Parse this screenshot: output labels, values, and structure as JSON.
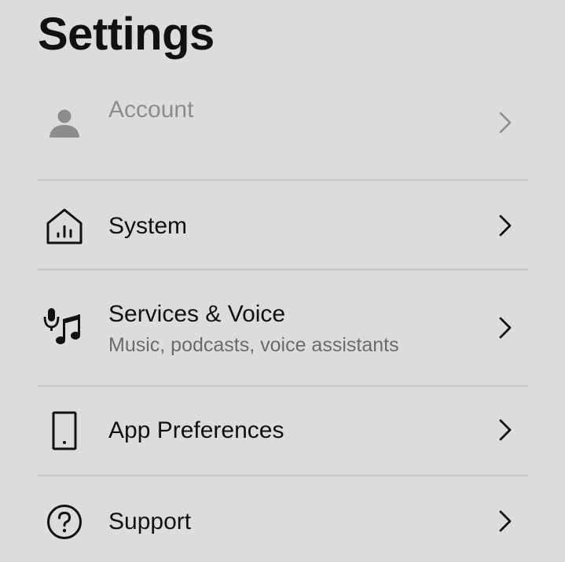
{
  "page": {
    "title": "Settings"
  },
  "settings": {
    "items": [
      {
        "label": "Account",
        "subtitle": "",
        "icon": "person-icon",
        "state": "dimmed"
      },
      {
        "label": "System",
        "subtitle": "",
        "icon": "home-stats-icon",
        "state": "normal"
      },
      {
        "label": "Services & Voice",
        "subtitle": "Music, podcasts, voice assistants",
        "icon": "mic-music-icon",
        "state": "normal"
      },
      {
        "label": "App Preferences",
        "subtitle": "",
        "icon": "phone-icon",
        "state": "normal"
      },
      {
        "label": "Support",
        "subtitle": "",
        "icon": "help-circle-icon",
        "state": "normal"
      }
    ]
  },
  "colors": {
    "background": "#dcdcdc",
    "text_primary": "#111111",
    "text_secondary": "#6b6b6b",
    "text_dimmed": "#8c8c8c",
    "divider": "#c4c4c4"
  }
}
